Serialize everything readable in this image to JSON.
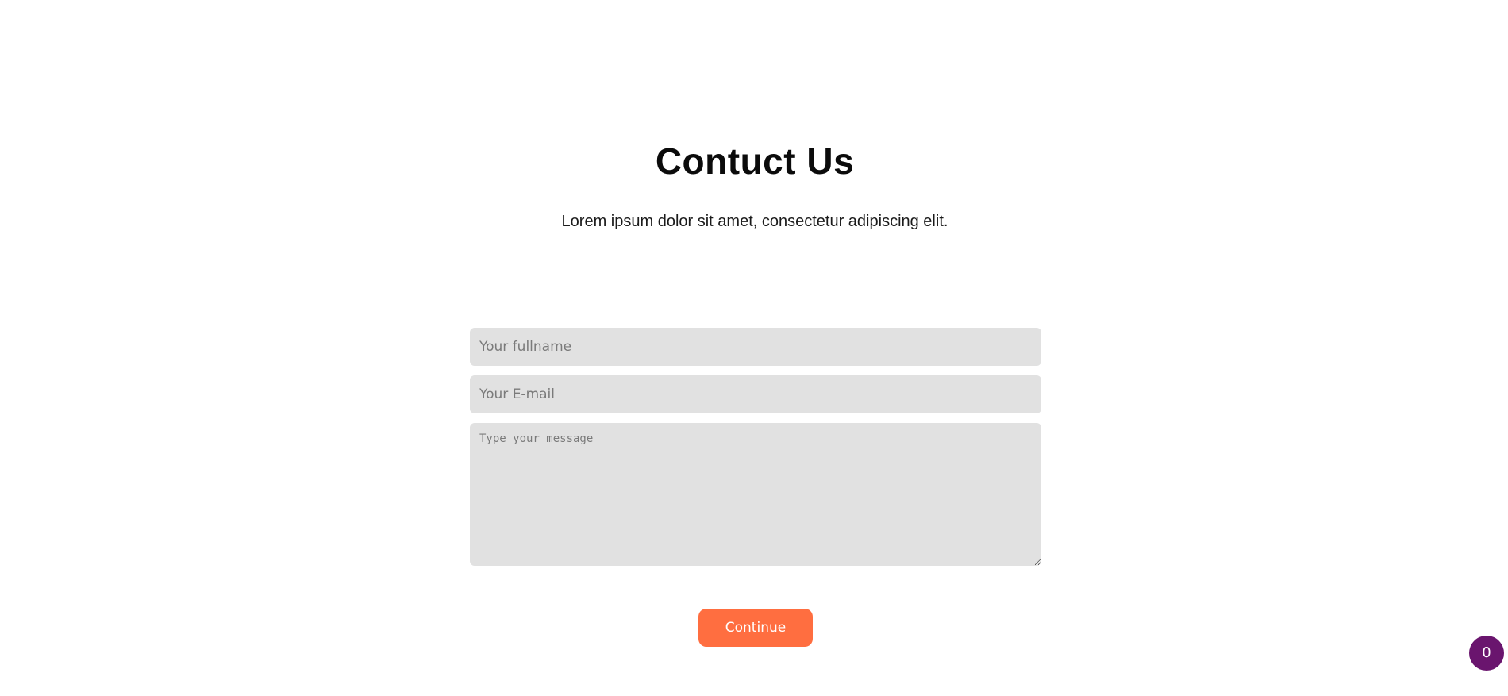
{
  "contact": {
    "title": "Contuct Us",
    "subtitle": "Lorem ipsum dolor sit amet, consectetur adipiscing elit."
  },
  "form": {
    "fullname": {
      "value": "",
      "placeholder": "Your fullname"
    },
    "email": {
      "value": "",
      "placeholder": "Your E-mail"
    },
    "message": {
      "value": "",
      "placeholder": "Type your message"
    },
    "submit_label": "Continue"
  },
  "badge": {
    "count": "0"
  },
  "colors": {
    "accent": "#ff6e40",
    "badge": "#6a156e",
    "field_bg": "#e1e1e1"
  }
}
